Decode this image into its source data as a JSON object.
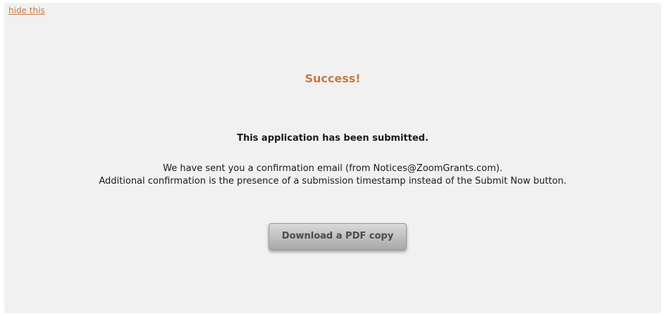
{
  "panel": {
    "hide_link": "hide this",
    "title": "Success!",
    "submitted_message": "This application has been submitted.",
    "confirmation_line_1": "We have sent you a confirmation email (from Notices@ZoomGrants.com).",
    "confirmation_line_2": "Additional confirmation is the presence of a submission timestamp instead of the Submit Now button.",
    "download_button_label": "Download a PDF copy"
  },
  "colors": {
    "accent": "#c57a44",
    "panel_background": "#f1f1f1",
    "text": "#1a1a1a"
  }
}
